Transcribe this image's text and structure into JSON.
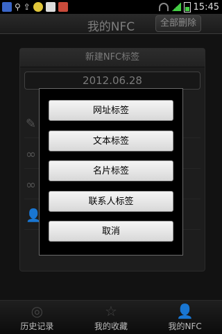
{
  "status_bar": {
    "time": "15:45",
    "icons": [
      "shield-icon",
      "usb-icon",
      "upload-icon",
      "app-icon",
      "mail-icon",
      "calendar-icon",
      "wifi-icon",
      "signal-icon",
      "battery-icon"
    ]
  },
  "header": {
    "title": "我的NFC",
    "clear_all_label": "全部删除"
  },
  "background_card": {
    "title": "新建NFC标签",
    "date": "2012.06.28",
    "row_icons": [
      "edit-icon",
      "link-icon",
      "link-icon",
      "contact-icon"
    ]
  },
  "dialog": {
    "options": [
      "网址标签",
      "文本标签",
      "名片标签",
      "联系人标签",
      "取消"
    ]
  },
  "bottom_nav": {
    "items": [
      {
        "label": "历史记录",
        "icon": "history-icon"
      },
      {
        "label": "我的收藏",
        "icon": "star-icon"
      },
      {
        "label": "我的NFC",
        "icon": "nfc-user-icon"
      }
    ]
  },
  "colors": {
    "background": "#000000",
    "dialog_button": "#e6e6e6",
    "text_muted": "#7e7e7e"
  }
}
